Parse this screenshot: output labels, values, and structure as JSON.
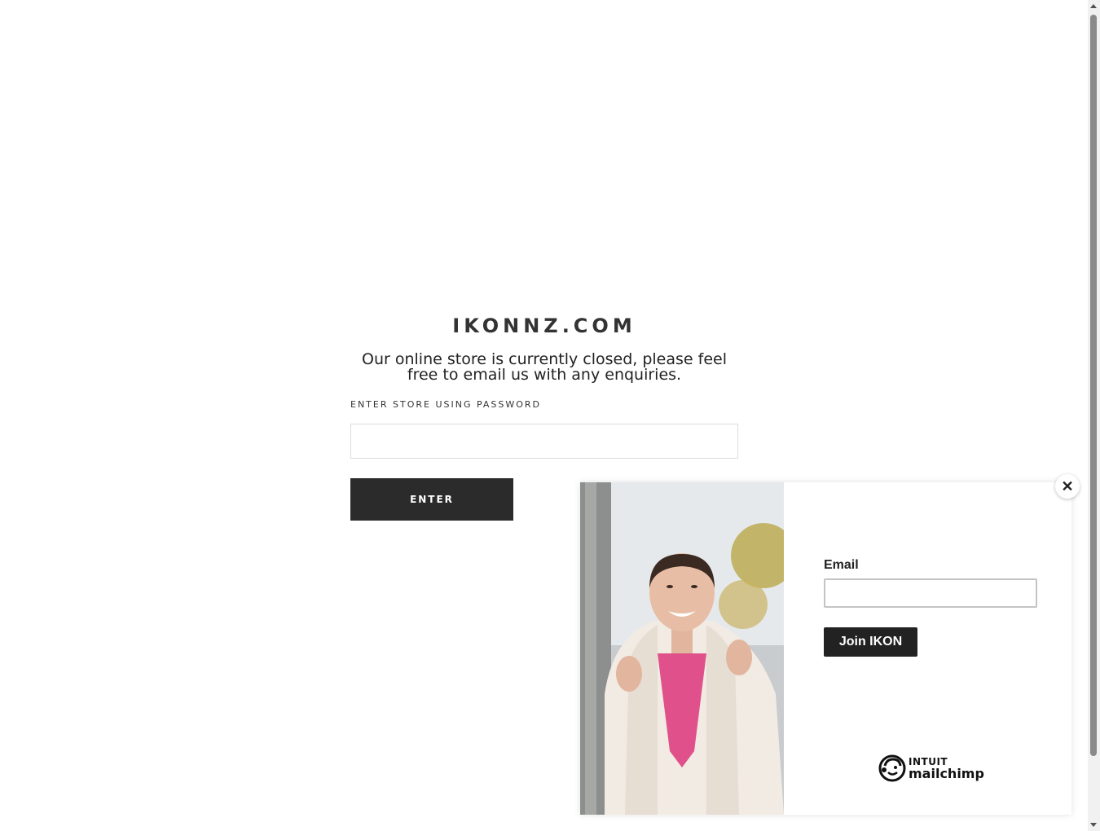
{
  "store": {
    "title": "IKONNZ.COM",
    "message": "Our online store is currently closed, please feel free to email us with any enquiries.",
    "password_label": "ENTER STORE USING PASSWORD",
    "password_placeholder": "",
    "enter_label": "ENTER"
  },
  "popup": {
    "close_symbol": "✕",
    "email_label": "Email",
    "email_value": "",
    "join_label": "Join IKON",
    "brand_top": "INTUIT",
    "brand_bottom": "mailchimp",
    "image_alt": "Smiling woman in white fur coat and pink top"
  },
  "colors": {
    "button_dark": "#2b2b2b",
    "join_button": "#222222",
    "background": "#ffffff"
  },
  "icons": {
    "close": "close-icon",
    "brand": "mailchimp-freddie-icon"
  }
}
